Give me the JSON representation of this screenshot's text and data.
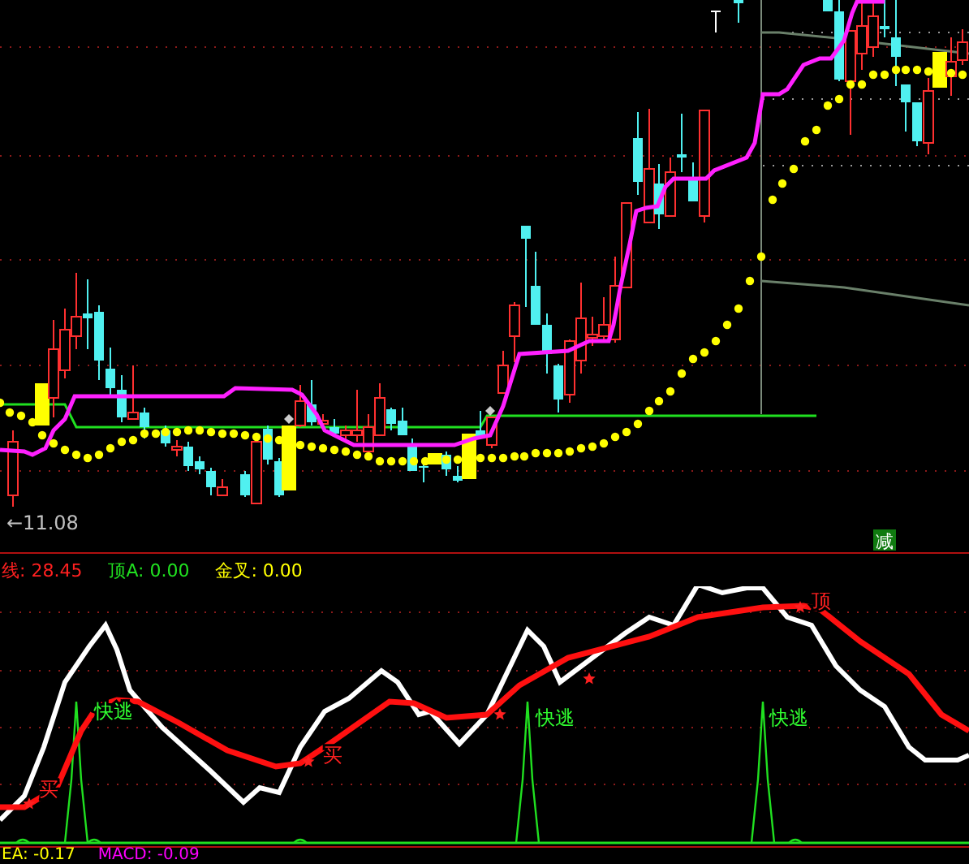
{
  "main_chart": {
    "price_label": "←11.08",
    "badge": "减"
  },
  "indicator_legend": [
    {
      "text": "线: 28.45",
      "color": "#ff2020"
    },
    {
      "text": "顶A: 0.00",
      "color": "#20e020"
    },
    {
      "text": "金叉: 0.00",
      "color": "#ffff00"
    }
  ],
  "oscillator": {
    "markers": [
      {
        "kind": "buy",
        "text": "买"
      },
      {
        "kind": "escape",
        "text": "快逃"
      },
      {
        "kind": "buy",
        "text": "买"
      },
      {
        "kind": "escape",
        "text": "快逃"
      },
      {
        "kind": "escape",
        "text": "快逃"
      },
      {
        "kind": "sell",
        "text": "顶"
      }
    ]
  },
  "macd_legend": [
    {
      "text": "EA: -0.17",
      "color": "#ffff00"
    },
    {
      "text": "MACD: -0.09",
      "color": "#ff00ff"
    }
  ]
}
